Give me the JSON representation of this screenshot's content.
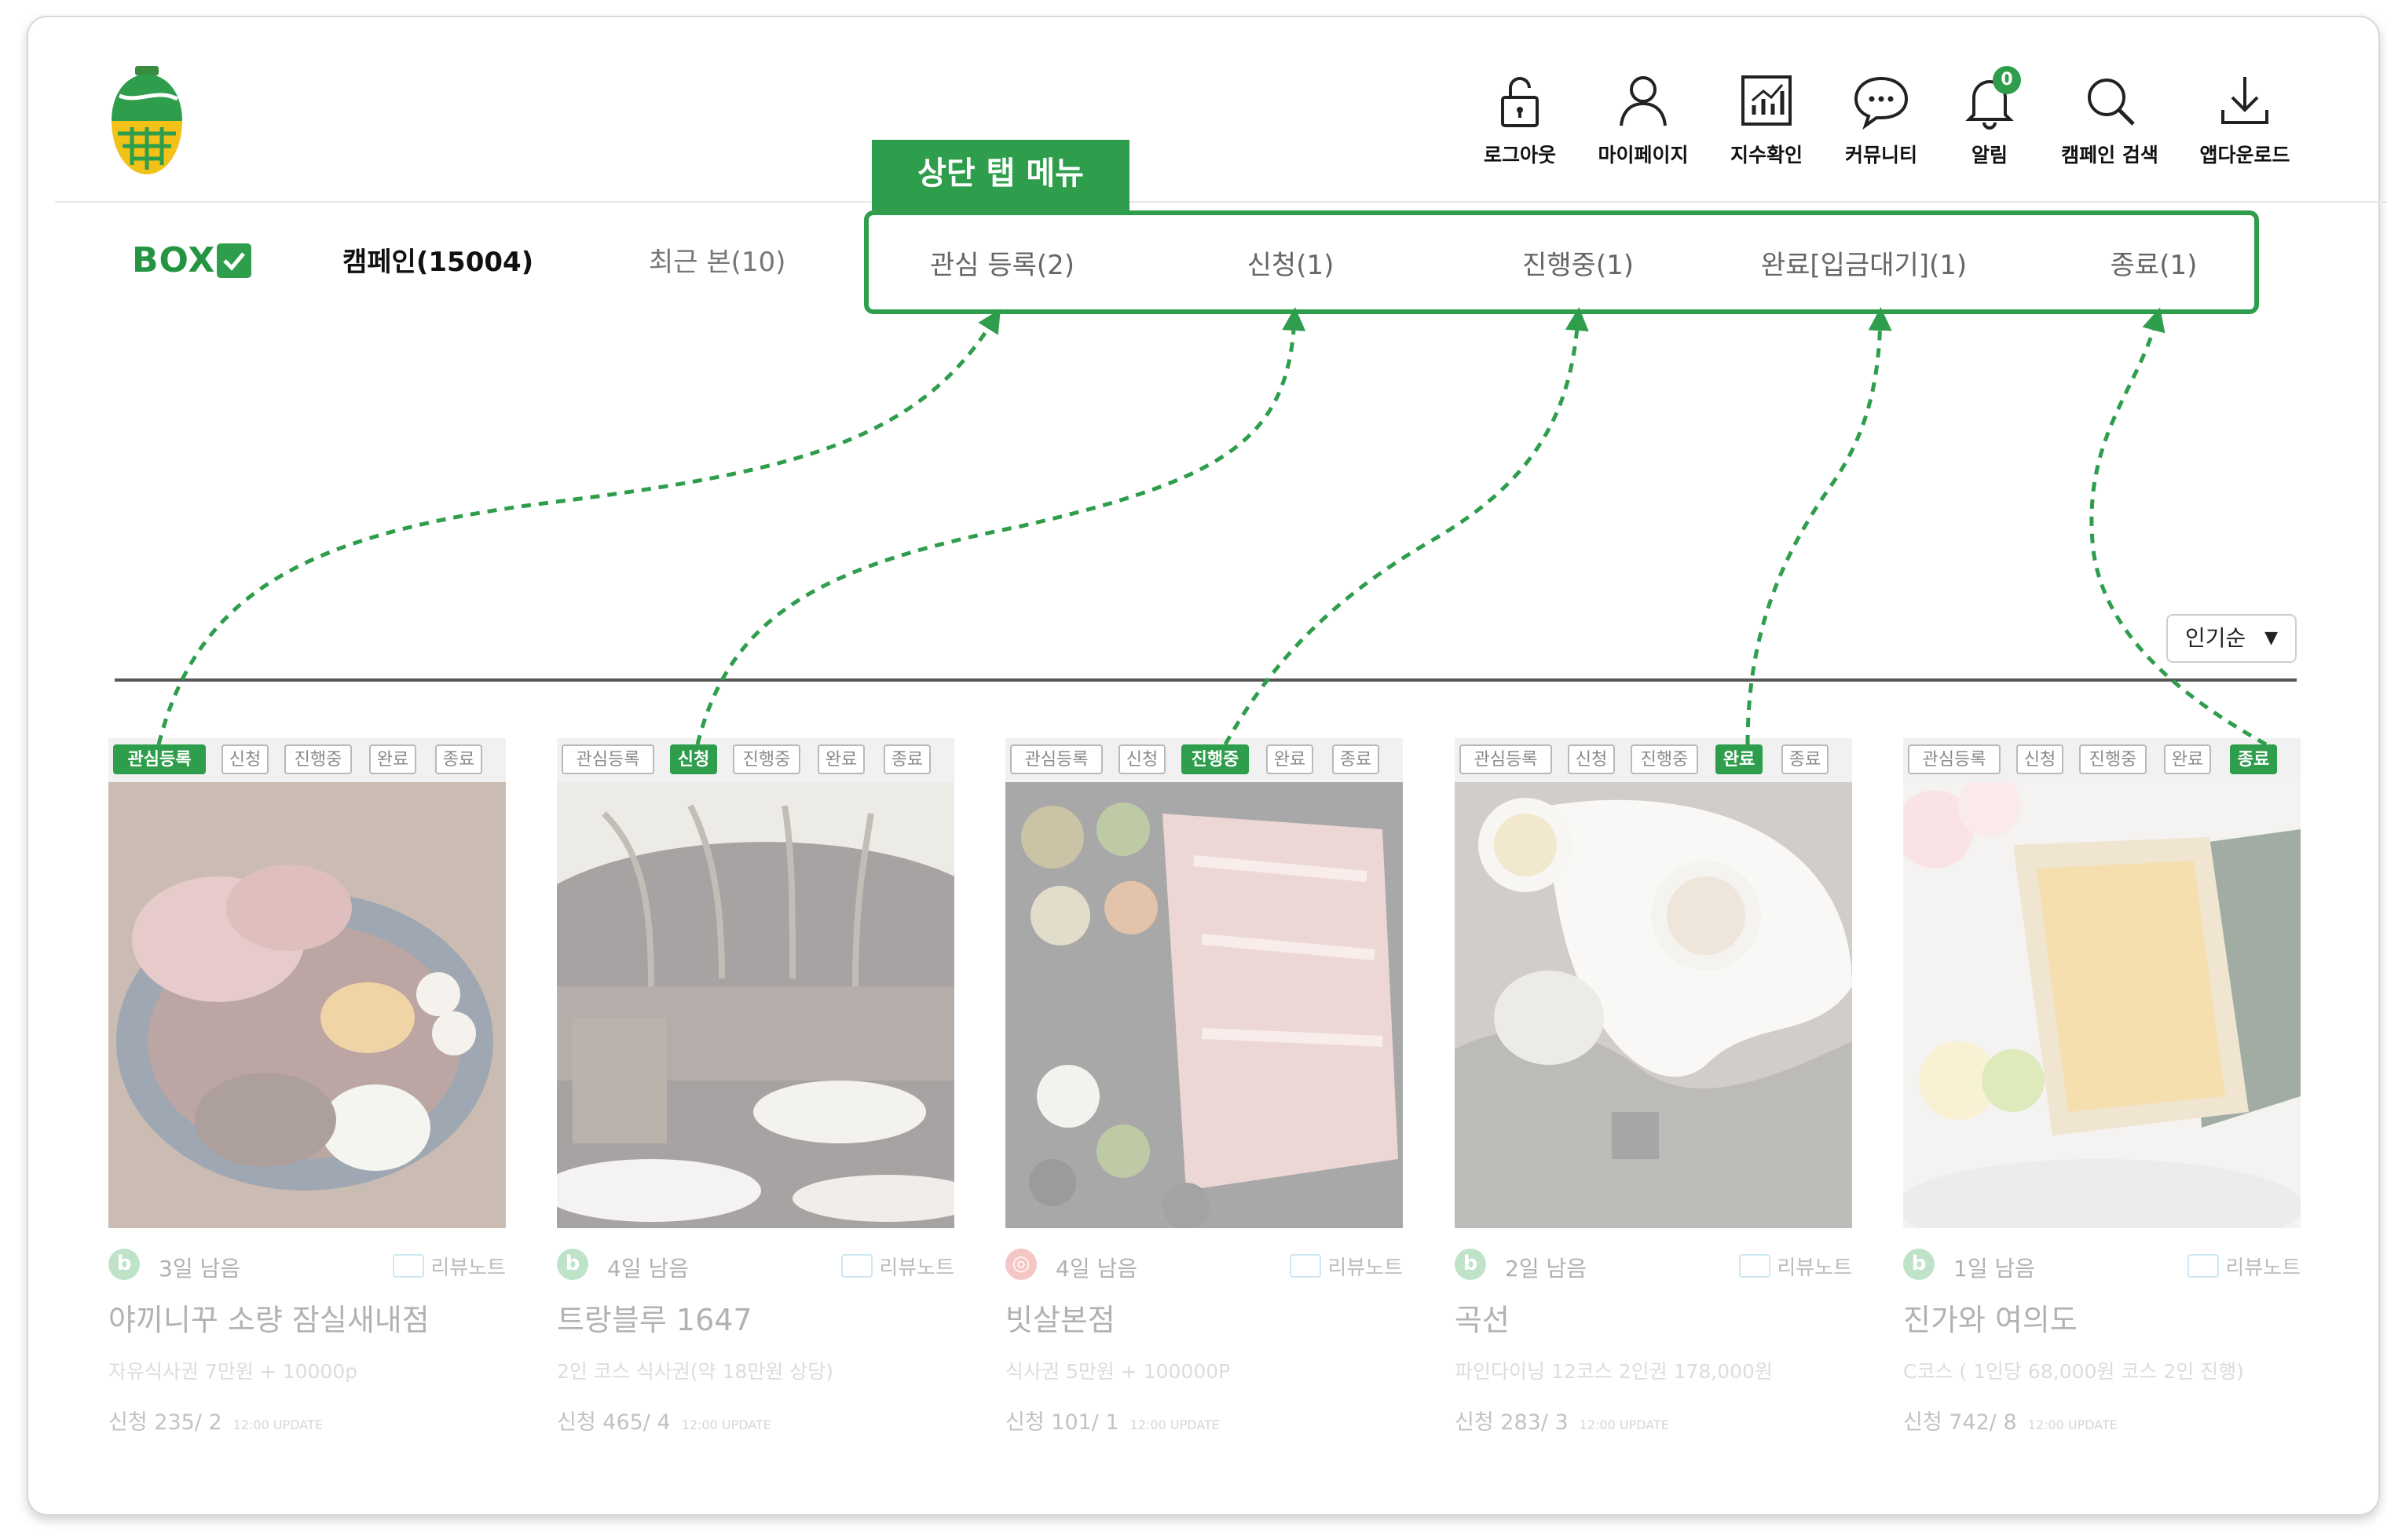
{
  "header": {
    "icons": [
      {
        "name": "lock-icon",
        "label": "로그아웃"
      },
      {
        "name": "user-icon",
        "label": "마이페이지"
      },
      {
        "name": "chart-icon",
        "label": "지수확인"
      },
      {
        "name": "chat-icon",
        "label": "커뮤니티"
      },
      {
        "name": "bell-icon",
        "label": "알림",
        "badge": "0"
      },
      {
        "name": "search-icon",
        "label": "캠페인 검색"
      },
      {
        "name": "download-icon",
        "label": "앱다운로드"
      }
    ]
  },
  "tabs": {
    "box_label": "BOX",
    "campaign": "캠페인(15004)",
    "recent": "최근 본(10)"
  },
  "top_menu": {
    "tag": "상단 탭 메뉴",
    "tabs": [
      "관심 등록(2)",
      "신청(1)",
      "진행중(1)",
      "완료[입금대기](1)",
      "종료(1)"
    ]
  },
  "sort": {
    "label": "인기순"
  },
  "status_chips": [
    "관심등록",
    "신청",
    "진행중",
    "완료",
    "종료"
  ],
  "cards": [
    {
      "active": 0,
      "platform": "blog",
      "platform_glyph": "b",
      "days": "3일 남음",
      "review": "리뷰노트",
      "name": "야끼니꾸 소량 잠실새내점",
      "desc": "자유식사권 7만원 + 10000p",
      "apply": "신청 235/ 2",
      "update": "12:00 UPDATE"
    },
    {
      "active": 1,
      "platform": "blog",
      "platform_glyph": "b",
      "days": "4일 남음",
      "review": "리뷰노트",
      "name": "트랑블루 1647",
      "desc": "2인 코스 식사권(약 18만원 상당)",
      "apply": "신청 465/ 4",
      "update": "12:00 UPDATE"
    },
    {
      "active": 2,
      "platform": "instagram",
      "platform_glyph": "◎",
      "days": "4일 남음",
      "review": "리뷰노트",
      "name": "빗살본점",
      "desc": "식사권 5만원 + 100000P",
      "apply": "신청 101/ 1",
      "update": "12:00 UPDATE"
    },
    {
      "active": 3,
      "platform": "blog",
      "platform_glyph": "b",
      "days": "2일 남음",
      "review": "리뷰노트",
      "name": "곡선",
      "desc": "파인다이닝 12코스 2인권 178,000원",
      "apply": "신청 283/ 3",
      "update": "12:00 UPDATE"
    },
    {
      "active": 4,
      "platform": "blog",
      "platform_glyph": "b",
      "days": "1일 남음",
      "review": "리뷰노트",
      "name": "진가와 여의도",
      "desc": "C코스 ( 1인당 68,000원 코스 2인 진행)",
      "apply": "신청 742/ 8",
      "update": "12:00 UPDATE"
    }
  ],
  "colors": {
    "brand": "#2e9d4c",
    "logo_yellow": "#f2c218"
  }
}
